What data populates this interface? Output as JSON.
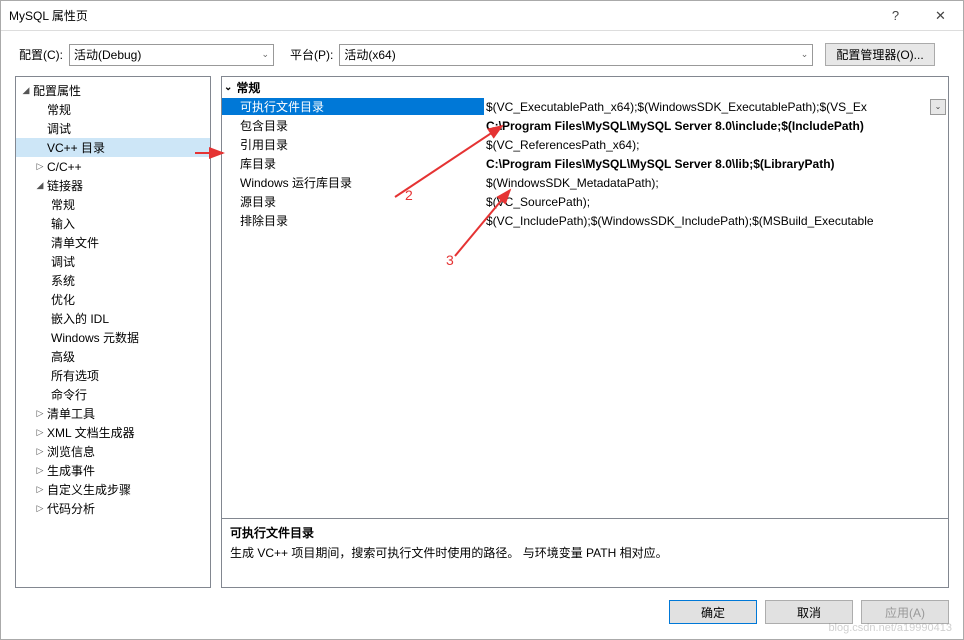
{
  "window": {
    "title": "MySQL 属性页",
    "help": "?",
    "close": "✕"
  },
  "toolbar": {
    "config_label": "配置(C):",
    "config_value": "活动(Debug)",
    "platform_label": "平台(P):",
    "platform_value": "活动(x64)",
    "config_mgr": "配置管理器(O)..."
  },
  "tree": {
    "root": "配置属性",
    "items": [
      "常规",
      "调试",
      "VC++ 目录",
      "C/C++",
      "链接器"
    ],
    "linker_children": [
      "常规",
      "输入",
      "清单文件",
      "调试",
      "系统",
      "优化",
      "嵌入的 IDL",
      "Windows 元数据",
      "高级",
      "所有选项",
      "命令行"
    ],
    "after": [
      "清单工具",
      "XML 文档生成器",
      "浏览信息",
      "生成事件",
      "自定义生成步骤",
      "代码分析"
    ]
  },
  "grid": {
    "group": "常规",
    "rows": [
      {
        "name": "可执行文件目录",
        "value": "$(VC_ExecutablePath_x64);$(WindowsSDK_ExecutablePath);$(VS_Ex",
        "bold": false,
        "selected": true,
        "dd": true
      },
      {
        "name": "包含目录",
        "value": "C:\\Program Files\\MySQL\\MySQL Server 8.0\\include;$(IncludePath)",
        "bold": true
      },
      {
        "name": "引用目录",
        "value": "$(VC_ReferencesPath_x64);",
        "bold": false
      },
      {
        "name": "库目录",
        "value": "C:\\Program Files\\MySQL\\MySQL Server 8.0\\lib;$(LibraryPath)",
        "bold": true
      },
      {
        "name": "Windows 运行库目录",
        "value": "$(WindowsSDK_MetadataPath);",
        "bold": false
      },
      {
        "name": "源目录",
        "value": "$(VC_SourcePath);",
        "bold": false
      },
      {
        "name": "排除目录",
        "value": "$(VC_IncludePath);$(WindowsSDK_IncludePath);$(MSBuild_Executable",
        "bold": false
      }
    ]
  },
  "desc": {
    "title": "可执行文件目录",
    "text": "生成 VC++ 项目期间，搜索可执行文件时使用的路径。   与环境变量 PATH 相对应。"
  },
  "buttons": {
    "ok": "确定",
    "cancel": "取消",
    "apply": "应用(A)"
  },
  "annot": {
    "a2": "2",
    "a3": "3"
  },
  "watermark": "blog.csdn.net/a19990413"
}
